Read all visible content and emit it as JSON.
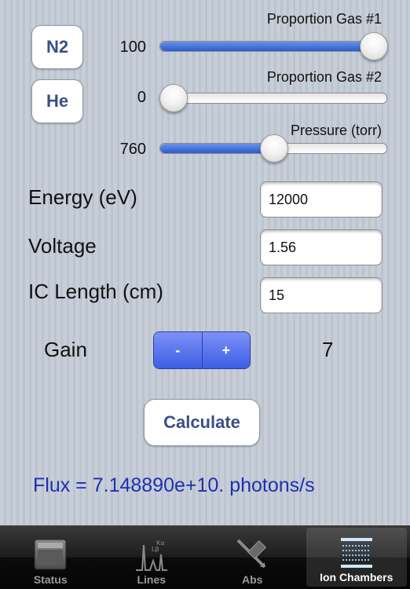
{
  "gas_buttons": {
    "gas1": "N2",
    "gas2": "He"
  },
  "sliders": [
    {
      "label": "Proportion Gas #1",
      "value": "100",
      "fraction": 1.0
    },
    {
      "label": "Proportion Gas #2",
      "value": "0",
      "fraction": 0.0
    },
    {
      "label": "Pressure (torr)",
      "value": "760",
      "fraction": 0.5
    }
  ],
  "fields": [
    {
      "label": "Energy (eV)",
      "value": "12000"
    },
    {
      "label": "Voltage",
      "value": "1.56"
    },
    {
      "label": "IC Length (cm)",
      "value": "15"
    }
  ],
  "gain": {
    "label": "Gain",
    "minus": "-",
    "plus": "+",
    "value": "7"
  },
  "calculate_label": "Calculate",
  "flux_text": "Flux = 7.148890e+10. photons/s",
  "tabs": [
    {
      "label": "Status",
      "icon": "status-icon"
    },
    {
      "label": "Lines",
      "icon": "lines-icon"
    },
    {
      "label": "Abs",
      "icon": "abs-icon"
    },
    {
      "label": "Ion Chambers",
      "icon": "ion-chambers-icon",
      "selected": true
    }
  ],
  "colors": {
    "accent": "#3d5ee6",
    "flux_text": "#1f2fb0",
    "button_text": "#3a4f86"
  }
}
